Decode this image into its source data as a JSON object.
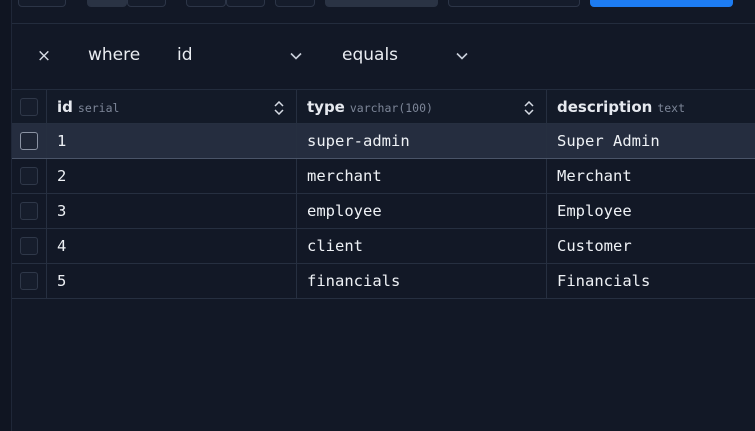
{
  "filter": {
    "close_glyph": "×",
    "where_label": "where",
    "column_value": "id",
    "operator_value": "equals"
  },
  "table": {
    "columns": [
      {
        "name": "id",
        "type": "serial"
      },
      {
        "name": "type",
        "type": "varchar(100)"
      },
      {
        "name": "description",
        "type": "text"
      }
    ],
    "rows": [
      {
        "id": "1",
        "type": "super-admin",
        "description": "Super Admin"
      },
      {
        "id": "2",
        "type": "merchant",
        "description": "Merchant"
      },
      {
        "id": "3",
        "type": "employee",
        "description": "Employee"
      },
      {
        "id": "4",
        "type": "client",
        "description": "Customer"
      },
      {
        "id": "5",
        "type": "financials",
        "description": "Financials"
      }
    ],
    "selected_row": 0
  },
  "colors": {
    "background": "#121826",
    "selected_row": "#252d3f",
    "primary_button": "#1d7cf2"
  }
}
